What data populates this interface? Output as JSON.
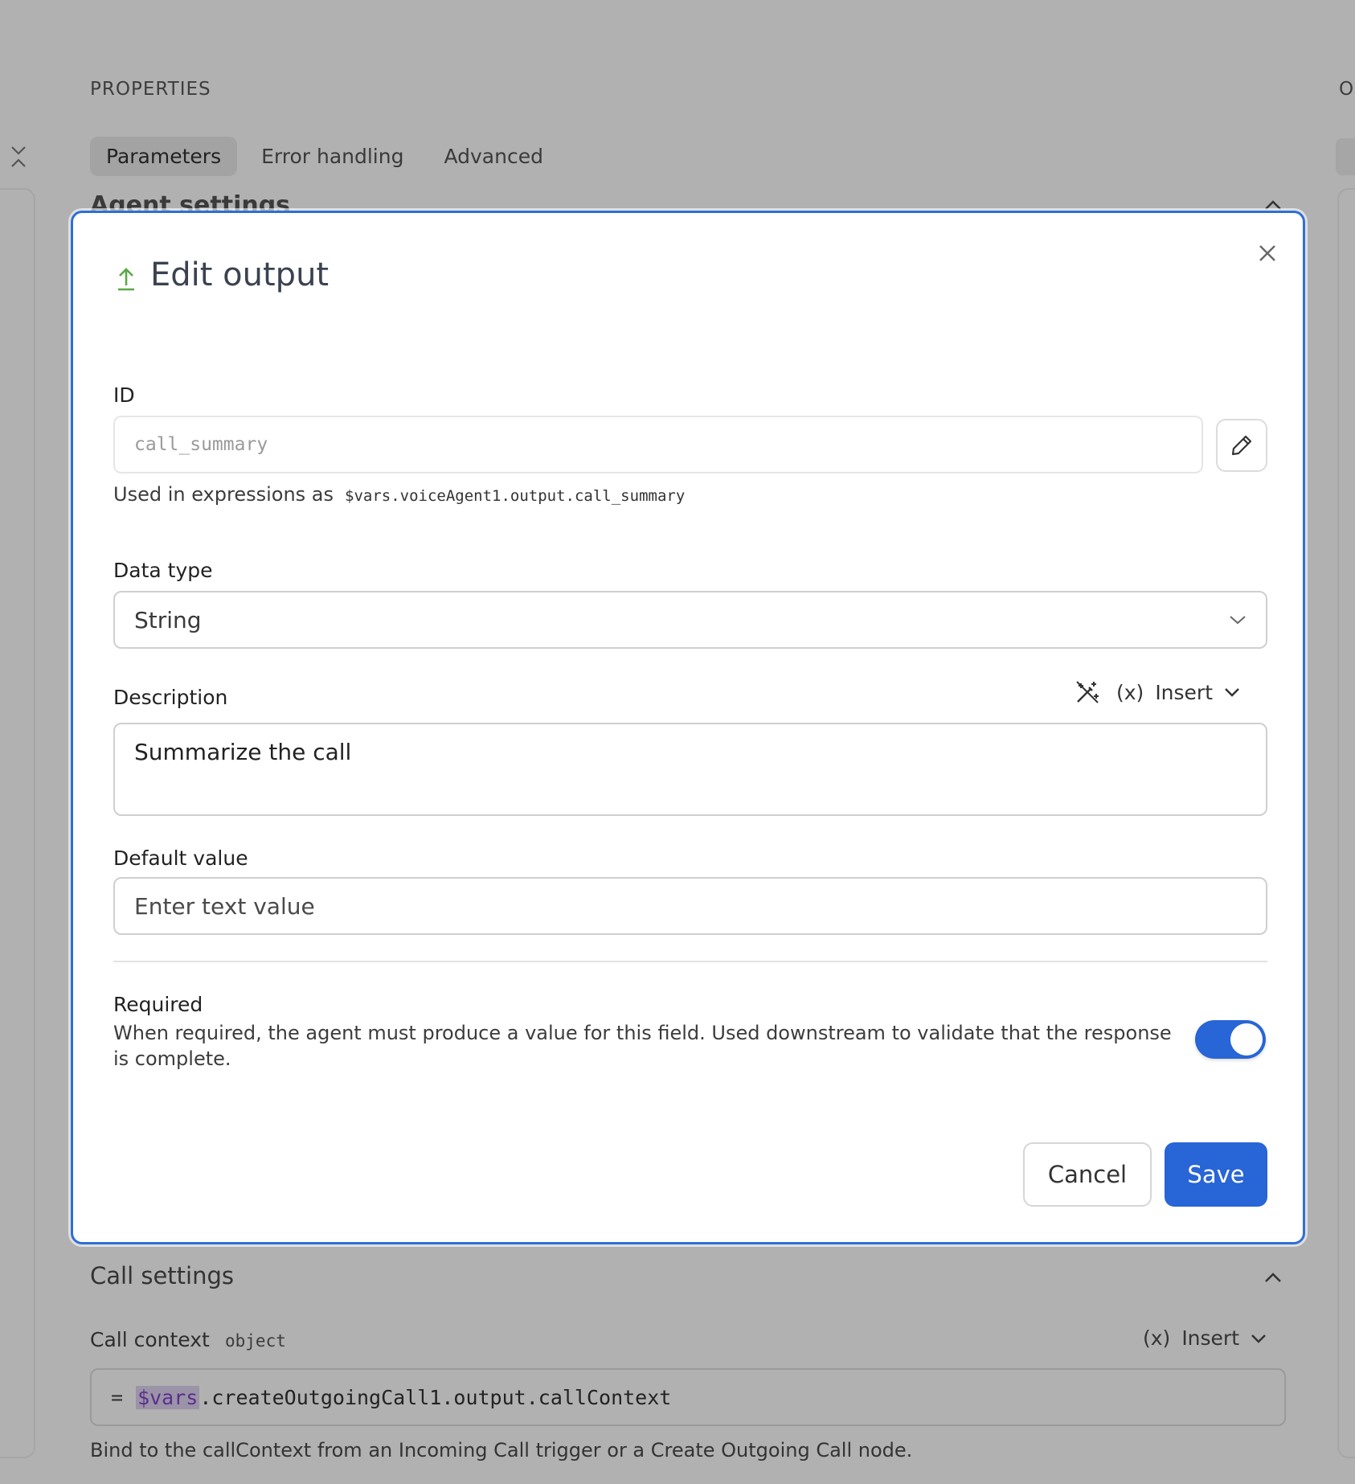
{
  "background": {
    "section_title": "PROPERTIES",
    "right_partial_letter": "O",
    "tabs": [
      {
        "label": "Parameters",
        "active": true
      },
      {
        "label": "Error handling",
        "active": false
      },
      {
        "label": "Advanced",
        "active": false
      }
    ],
    "partial_heading": "Agent settings",
    "call_settings": {
      "heading": "Call settings",
      "call_context_label": "Call context",
      "call_context_type": "object",
      "insert_label": "Insert",
      "expression_prefix": "=",
      "expression_var": "$vars",
      "expression_rest": ".createOutgoingCall1.output.callContext",
      "help_text": "Bind to the callContext from an Incoming Call trigger or a Create Outgoing Call node."
    }
  },
  "modal": {
    "title": "Edit output",
    "id_label": "ID",
    "id_value": "call_summary",
    "id_help_prefix": "Used in expressions as",
    "id_help_expression": "$vars.voiceAgent1.output.call_summary",
    "data_type_label": "Data type",
    "data_type_value": "String",
    "description_label": "Description",
    "insert_label": "Insert",
    "description_value": "Summarize the call",
    "default_label": "Default value",
    "default_placeholder": "Enter text value",
    "required_label": "Required",
    "required_desc": "When required, the agent must produce a value for this field. Used downstream to validate that the response is complete.",
    "required_on": true,
    "cancel_label": "Cancel",
    "save_label": "Save"
  },
  "colors": {
    "accent": "#2865d6",
    "modal_border": "#2f6fd6",
    "title_icon": "#5aa845",
    "overlay": "#b1b1b1"
  },
  "icons": {
    "collapse": "collapse-icon",
    "title": "upload-arrow-icon",
    "close": "close-icon",
    "edit": "pencil-icon",
    "select": "chevron-down-icon",
    "magic": "magic-wand-icon",
    "variable": "variable-icon"
  }
}
